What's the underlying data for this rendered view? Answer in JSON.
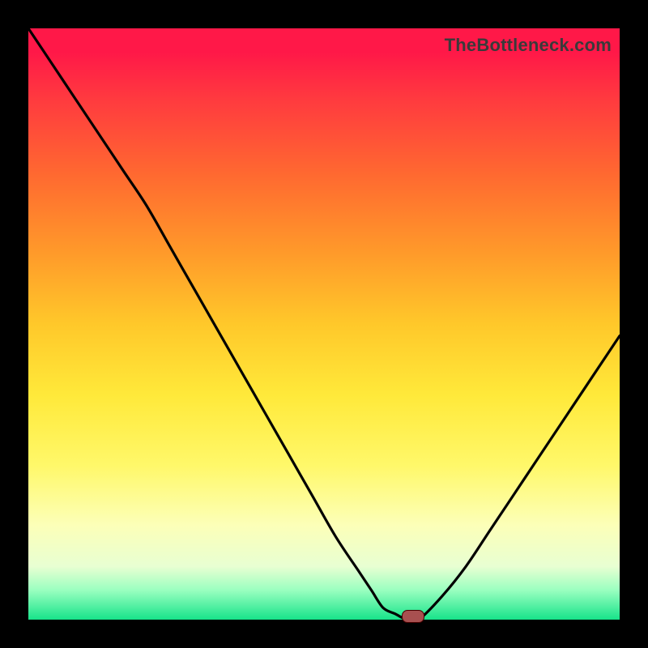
{
  "attribution": "TheBottleneck.com",
  "colors": {
    "frame": "#000000",
    "curve": "#000000",
    "marker_fill": "#a85050",
    "marker_border": "#4a0000"
  },
  "chart_data": {
    "type": "line",
    "title": "",
    "xlabel": "",
    "ylabel": "",
    "xlim": [
      0,
      100
    ],
    "ylim": [
      0,
      100
    ],
    "grid": false,
    "legend": false,
    "series": [
      {
        "name": "bottleneck-curve",
        "x": [
          0,
          4,
          8,
          12,
          16,
          20,
          24,
          28,
          32,
          36,
          40,
          44,
          48,
          52,
          56,
          58,
          60,
          62,
          64,
          66,
          70,
          74,
          78,
          82,
          86,
          90,
          94,
          98,
          100
        ],
        "y": [
          100,
          94,
          88,
          82,
          76,
          70,
          63,
          56,
          49,
          42,
          35,
          28,
          21,
          14,
          8,
          5,
          2,
          1,
          0,
          0,
          4,
          9,
          15,
          21,
          27,
          33,
          39,
          45,
          48
        ]
      }
    ],
    "marker": {
      "x": 65,
      "y": 0
    },
    "gradient_stops": [
      {
        "pos": 0,
        "color": "#ff1848"
      },
      {
        "pos": 50,
        "color": "#ffc82a"
      },
      {
        "pos": 84,
        "color": "#fcffb8"
      },
      {
        "pos": 100,
        "color": "#17e38a"
      }
    ]
  }
}
